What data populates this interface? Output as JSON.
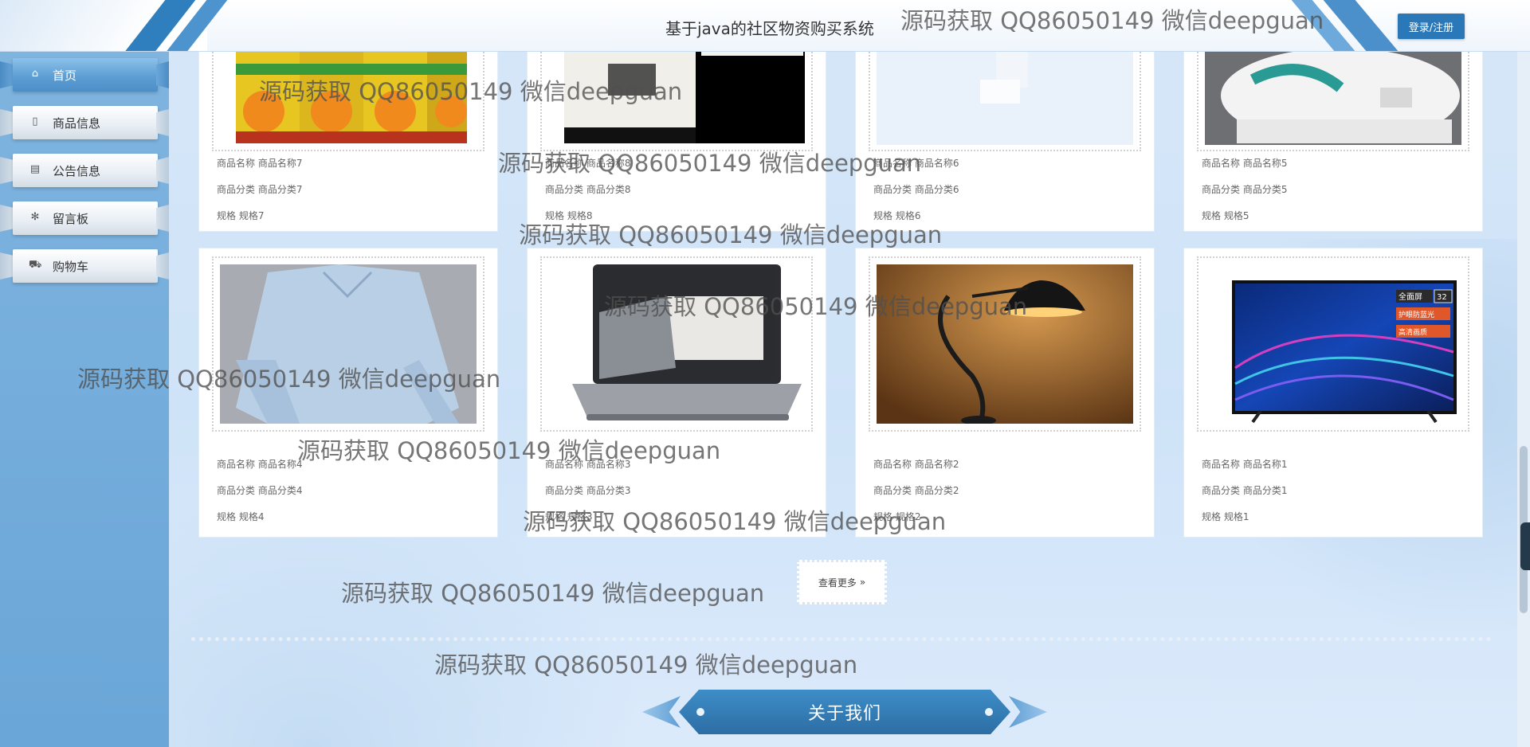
{
  "header": {
    "site_title": "基于java的社区物资购买系统",
    "login_label": "登录/注册"
  },
  "sidebar": {
    "items": [
      {
        "label": "首页",
        "icon": "home-icon",
        "active": true
      },
      {
        "label": "商品信息",
        "icon": "document-icon",
        "active": false
      },
      {
        "label": "公告信息",
        "icon": "notice-icon",
        "active": false
      },
      {
        "label": "留言板",
        "icon": "asterisk-icon",
        "active": false
      },
      {
        "label": "购物车",
        "icon": "cart-icon",
        "active": false
      }
    ]
  },
  "products": {
    "row1": [
      {
        "name": "商品名称 商品名称7",
        "category": "商品分类 商品分类7",
        "spec": "规格 规格7",
        "image": "juice-boxes"
      },
      {
        "name": "商品名称 商品名称8",
        "category": "商品分类 商品分类8",
        "spec": "规格 规格8",
        "image": "books"
      },
      {
        "name": "商品名称 商品名称6",
        "category": "商品分类 商品分类6",
        "spec": "规格 规格6",
        "image": "light-product"
      },
      {
        "name": "商品名称 商品名称5",
        "category": "商品分类 商品分类5",
        "spec": "规格 规格5",
        "image": "sneaker"
      }
    ],
    "row2": [
      {
        "name": "商品名称 商品名称4",
        "category": "商品分类 商品分类4",
        "spec": "规格 规格4",
        "image": "blouse"
      },
      {
        "name": "商品名称 商品名称3",
        "category": "商品分类 商品分类3",
        "spec": "规格 规格3",
        "image": "laptop"
      },
      {
        "name": "商品名称 商品名称2",
        "category": "商品分类 商品分类2",
        "spec": "规格 规格2",
        "image": "desk-lamp"
      },
      {
        "name": "商品名称 商品名称1",
        "category": "商品分类 商品分类1",
        "spec": "规格 规格1",
        "image": "television"
      }
    ]
  },
  "tv_badges": [
    "全面屏",
    "32",
    "护眼防蓝光",
    "高清画质"
  ],
  "more_label": "查看更多",
  "more_icon": "double-chevron-right-icon",
  "about_title": "关于我们",
  "watermark_text": "源码获取 QQ86050149 微信deepguan",
  "colors": {
    "primary": "#2b78b8",
    "sidebar": "#7fb4df",
    "page_bg": "#d6e7f8"
  }
}
